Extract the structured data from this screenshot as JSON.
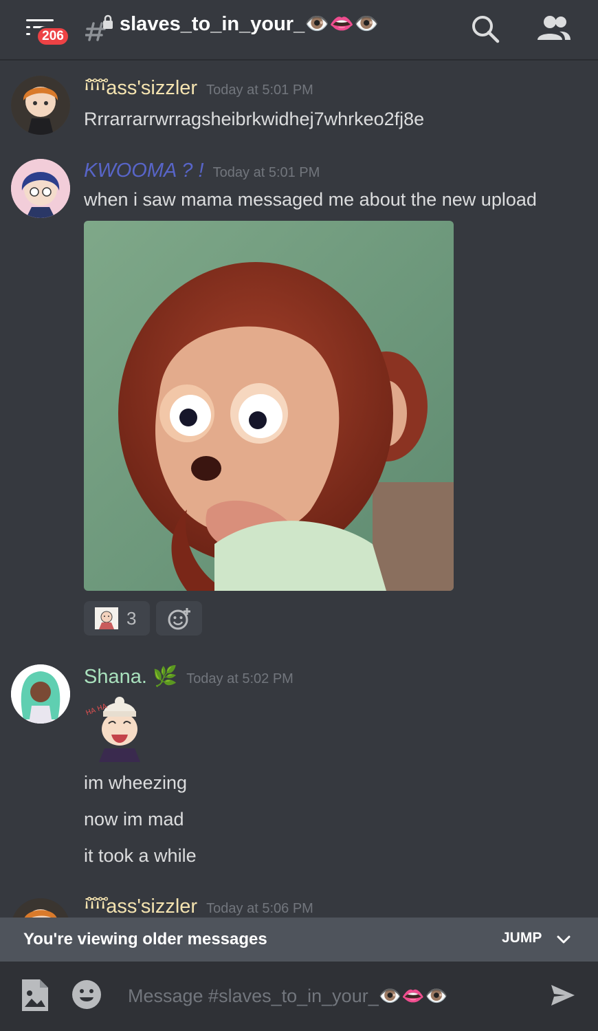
{
  "header": {
    "unread_count": "206",
    "channel_name": "slaves_to_in_your_👁️👄👁️"
  },
  "messages": [
    {
      "author": "ꜟ̊̊̊̊̊̊ꜟ̊̊ꜟ̊̊ꜟ̊̊ass'sizzler",
      "author_color": "#f4e3b0",
      "timestamp": "Today at 5:01 PM",
      "lines": [
        "Rrrarrarrwrragsheibrkwidhej7whrkeo2fj8e"
      ]
    },
    {
      "author": "KWOOMA ? !",
      "author_color": "#5865c8",
      "timestamp": "Today at 5:01 PM",
      "lines": [
        "when i saw mama messaged me about the new upload"
      ],
      "attachment": "monkey-puppet-image",
      "reactions": [
        {
          "emoji": "sticker-face",
          "count": "3"
        }
      ]
    },
    {
      "author": "Shana. 🌿",
      "author_color": "#a9e1bd",
      "timestamp": "Today at 5:02 PM",
      "sticker": "laughing-boy-sticker",
      "lines": [
        "im wheezing",
        "now im mad",
        "it took a while"
      ]
    },
    {
      "author": "ꜟ̊̊̊̊̊̊ꜟ̊̊ꜟ̊̊ꜟ̊̊ass'sizzler",
      "author_color": "#f4e3b0",
      "timestamp": "Today at 5:06 PM"
    }
  ],
  "older_bar": {
    "text": "You're viewing older messages",
    "jump_label": "JUMP"
  },
  "composer": {
    "placeholder": "Message #slaves_to_in_your_👁️👄👁️"
  },
  "colors": {
    "background": "#36393f",
    "composer": "#2f3136",
    "badge": "#ed4245",
    "older_bar": "#4f545c"
  }
}
